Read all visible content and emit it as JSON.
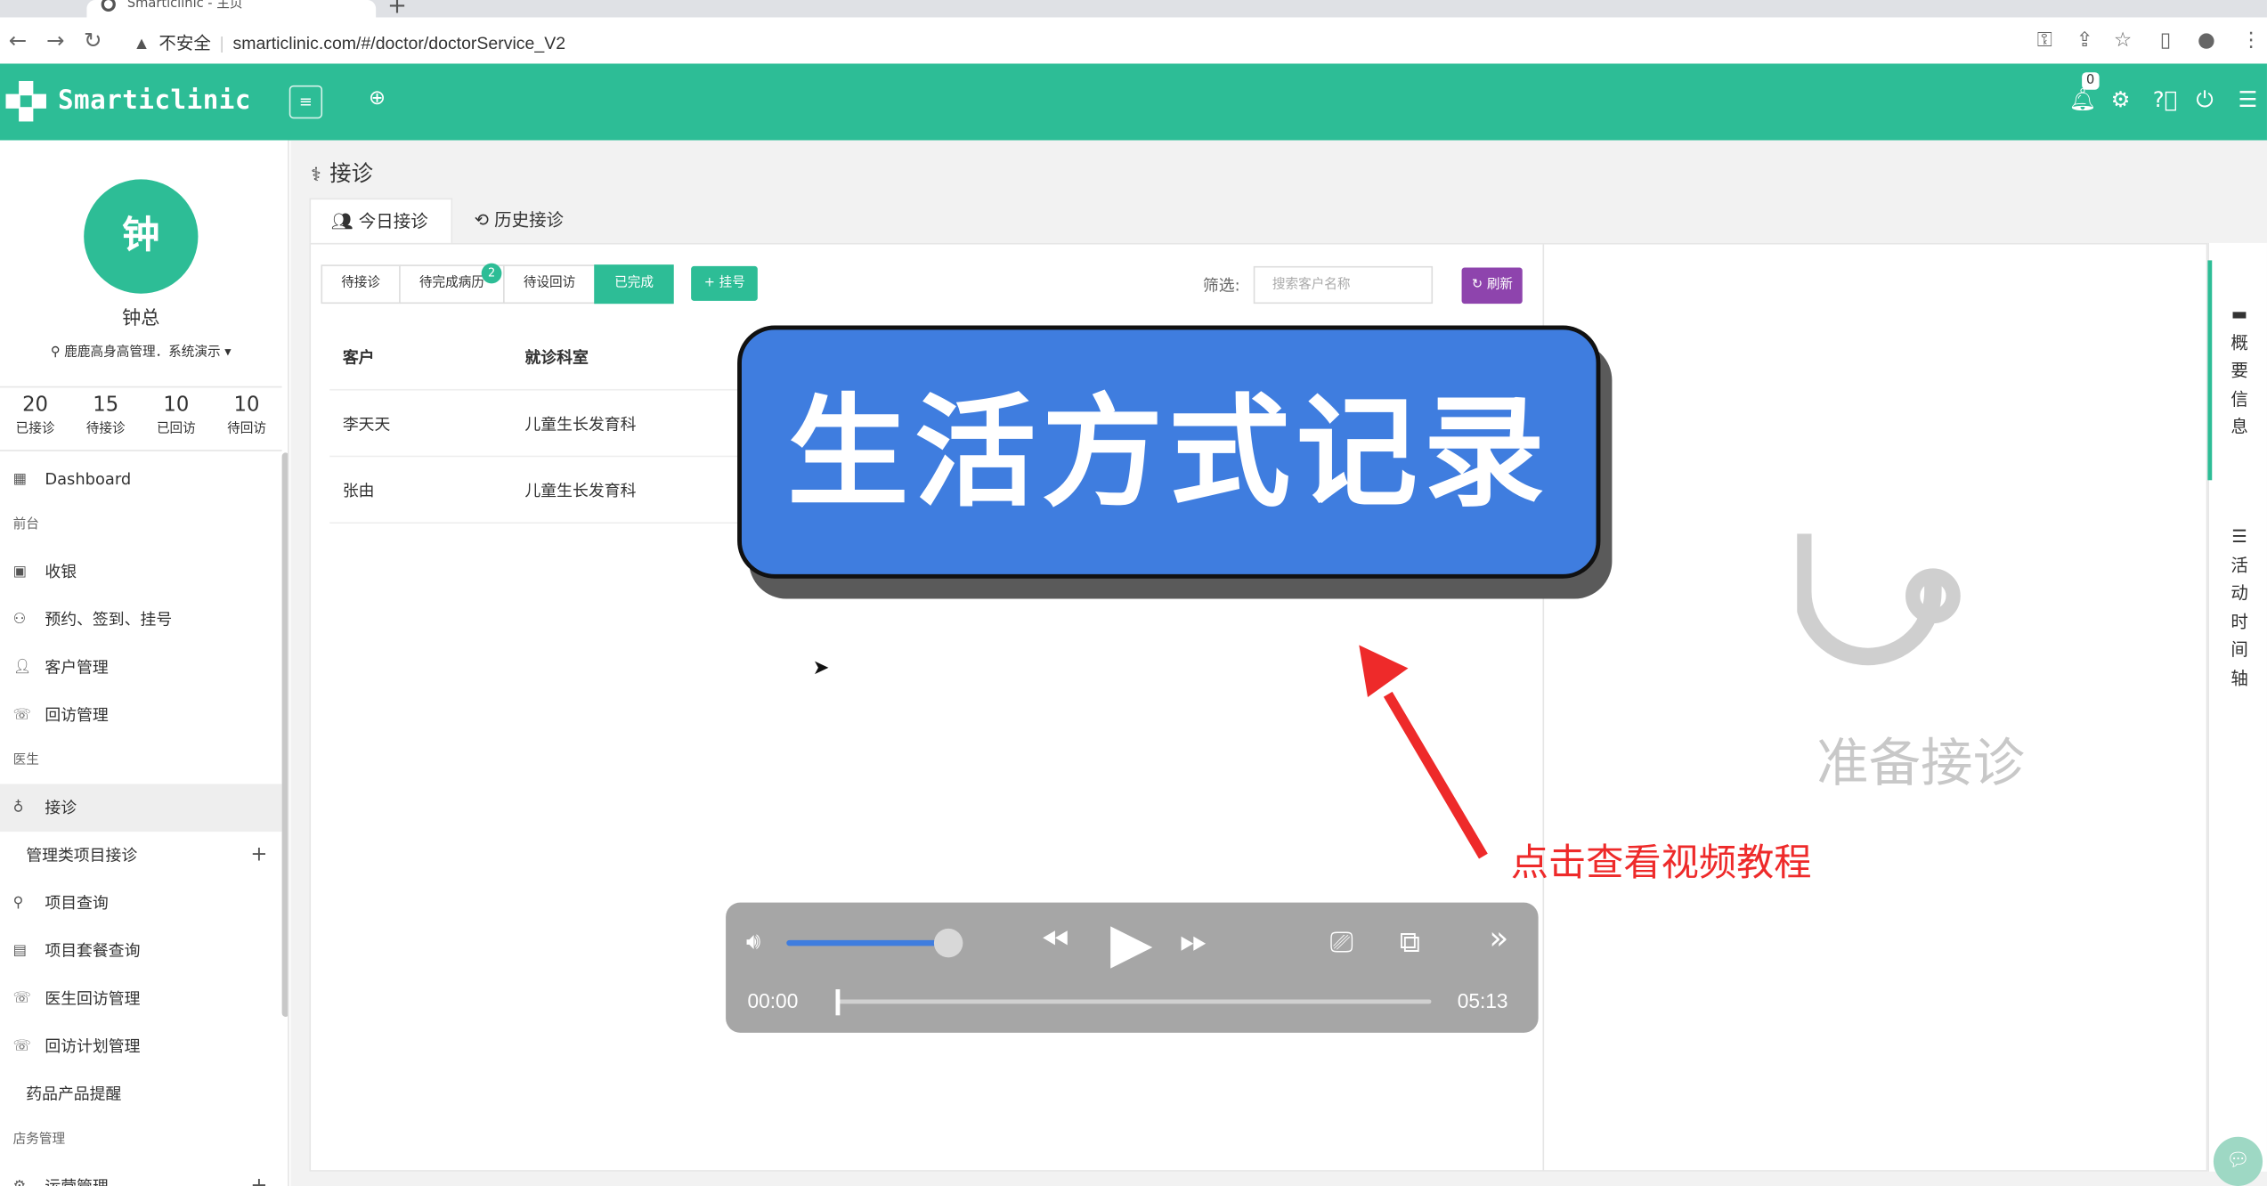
{
  "browser": {
    "tab_title": "Smarticlinic - 主页",
    "url_warning": "不安全",
    "url": "smarticlinic.com/#/doctor/doctorService_V2"
  },
  "header": {
    "app_name": "Smarticlinic",
    "notification_count": "0",
    "accent_color": "#2dbd96"
  },
  "sidebar": {
    "avatar_char": "钟",
    "user_name": "钟总",
    "org": "鹿鹿高身高管理．系统演示",
    "stats": [
      {
        "num": "20",
        "label": "已接诊"
      },
      {
        "num": "15",
        "label": "待接诊"
      },
      {
        "num": "10",
        "label": "已回访"
      },
      {
        "num": "10",
        "label": "待回访"
      }
    ],
    "menu": [
      {
        "label": "Dashboard",
        "icon": "dashboard-icon"
      },
      {
        "label": "前台",
        "section": true
      },
      {
        "label": "收银",
        "icon": "cashier-icon"
      },
      {
        "label": "预约、签到、挂号",
        "icon": "appointment-icon"
      },
      {
        "label": "客户管理",
        "icon": "customer-icon"
      },
      {
        "label": "回访管理",
        "icon": "phone-icon"
      },
      {
        "label": "医生",
        "section": true
      },
      {
        "label": "接诊",
        "icon": "stethoscope-icon",
        "active": true
      },
      {
        "label": "管理类项目接诊",
        "sub": true,
        "plus": true
      },
      {
        "label": "项目查询",
        "icon": "search-icon"
      },
      {
        "label": "项目套餐查询",
        "icon": "package-icon"
      },
      {
        "label": "医生回访管理",
        "icon": "phone-icon"
      },
      {
        "label": "回访计划管理",
        "icon": "phone-icon"
      },
      {
        "label": "药品产品提醒",
        "sub": true
      },
      {
        "label": "店务管理",
        "section": true
      },
      {
        "label": "运营管理",
        "icon": "operation-icon",
        "plus": true
      }
    ]
  },
  "page": {
    "title": "接诊",
    "tabs": [
      "今日接诊",
      "历史接诊"
    ],
    "subtabs": [
      "待接诊",
      "待完成病历",
      "待设回访",
      "已完成"
    ],
    "subtab_badge": "2",
    "register_label": "+ 挂号",
    "filter_label": "筛选:",
    "search_placeholder": "搜索客户名称",
    "refresh_label": "刷新",
    "table": {
      "headers": [
        "客户",
        "就诊科室"
      ],
      "rows": [
        [
          "李天天",
          "儿童生长发育科"
        ],
        [
          "张由",
          "儿童生长发育科"
        ]
      ]
    },
    "empty_text": "准备接诊",
    "right_tabs": [
      "概要信息",
      "活动时间轴"
    ]
  },
  "overlay": {
    "banner": "生活方式记录",
    "hint": "点击查看视频教程",
    "video": {
      "current": "00:00",
      "duration": "05:13",
      "volume": 0.9,
      "progress": 0.0
    }
  }
}
